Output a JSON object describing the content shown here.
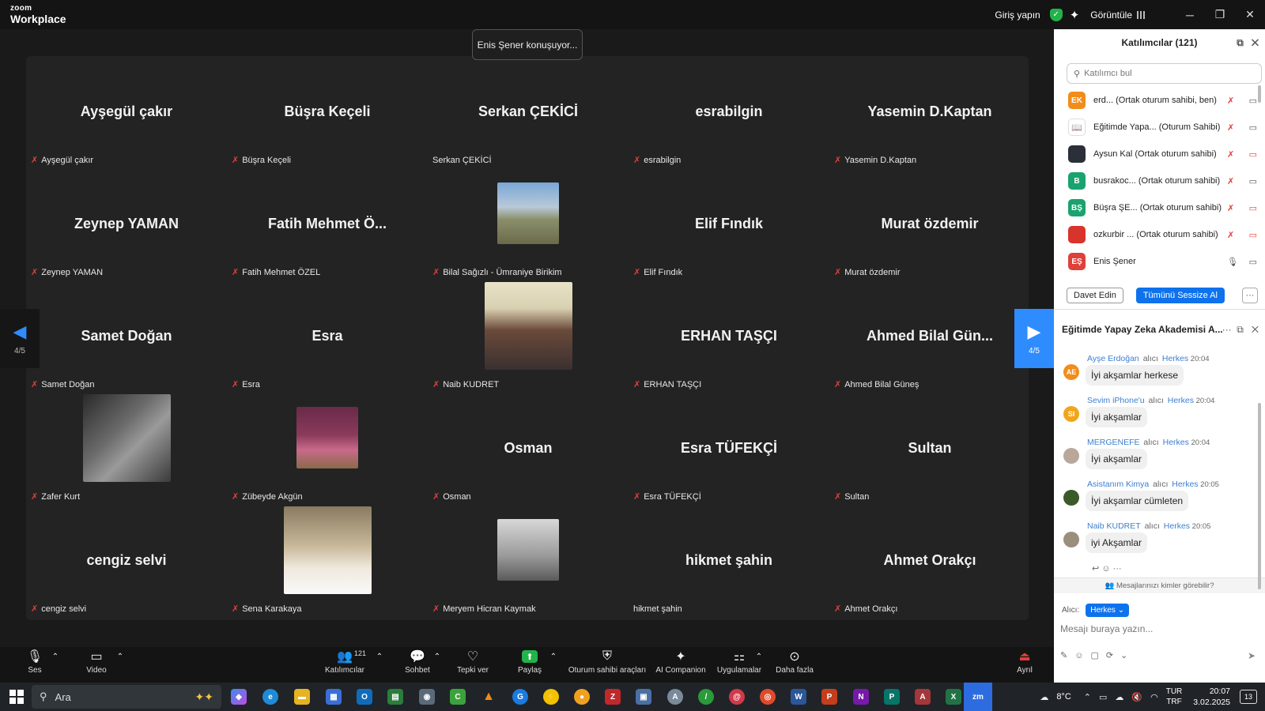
{
  "app": {
    "logo_top": "zoom",
    "logo_bottom": "Workplace"
  },
  "titlebar": {
    "signin": "Giriş yapın",
    "view": "Görüntüle",
    "min": "─",
    "max": "❐",
    "close": "✕"
  },
  "speaking": "Enis Şener konuşuyor...",
  "nav": {
    "left_page": "4/5",
    "right_page": "4/5"
  },
  "tiles": [
    {
      "big": "Ayşegül çakır",
      "label": "Ayşegül çakır",
      "muted": true
    },
    {
      "big": "Büşra Keçeli",
      "label": "Büşra Keçeli",
      "muted": true
    },
    {
      "big": "Serkan ÇEKİCİ",
      "label": "Serkan ÇEKİCİ",
      "muted": false
    },
    {
      "big": "esrabilgin",
      "label": "esrabilgin",
      "muted": true
    },
    {
      "big": "Yasemin D.Kaptan",
      "label": "Yasemin D.Kaptan",
      "muted": true
    },
    {
      "big": "Zeynep YAMAN",
      "label": "Zeynep YAMAN",
      "muted": true
    },
    {
      "big": "Fatih Mehmet Ö...",
      "label": "Fatih Mehmet ÖZEL",
      "muted": true
    },
    {
      "big": "",
      "label": "Bilal Sağızlı - Ümraniye Birikim",
      "muted": true,
      "photo": "landscape"
    },
    {
      "big": "Elif Fındık",
      "label": "Elif Fındık",
      "muted": true
    },
    {
      "big": "Murat özdemir",
      "label": "Murat özdemir",
      "muted": true
    },
    {
      "big": "Samet Doğan",
      "label": "Samet Doğan",
      "muted": true
    },
    {
      "big": "Esra",
      "label": "Esra",
      "muted": true
    },
    {
      "big": "",
      "label": "Naib KUDRET",
      "muted": true,
      "photo": "portrait"
    },
    {
      "big": "ERHAN TAŞÇI",
      "label": "ERHAN TAŞÇI",
      "muted": true
    },
    {
      "big": "Ahmed Bilal Gün...",
      "label": "Ahmed Bilal Güneş",
      "muted": true
    },
    {
      "big": "",
      "label": "Zafer Kurt",
      "muted": true,
      "photo": "couple"
    },
    {
      "big": "",
      "label": "Zübeyde Akgün",
      "muted": true,
      "photo": "flowers"
    },
    {
      "big": "Osman",
      "label": "Osman",
      "muted": true
    },
    {
      "big": "Esra TÜFEKÇİ",
      "label": "Esra TÜFEKÇİ",
      "muted": true
    },
    {
      "big": "Sultan",
      "label": "Sultan",
      "muted": true
    },
    {
      "big": "cengiz selvi",
      "label": "cengiz selvi",
      "muted": true
    },
    {
      "big": "",
      "label": "Sena Karakaya",
      "muted": true,
      "photo": "decor"
    },
    {
      "big": "",
      "label": "Meryem Hicran Kaymak",
      "muted": true,
      "photo": "misty"
    },
    {
      "big": "hikmet şahin",
      "label": "hikmet şahin",
      "muted": false
    },
    {
      "big": "Ahmet Orakçı",
      "label": "Ahmet Orakçı",
      "muted": true
    }
  ],
  "participants": {
    "title": "Katılımcılar (121)",
    "search_placeholder": "Katılımcı bul",
    "rows": [
      {
        "initials": "EK",
        "color": "#f28c1b",
        "name": "erd...  (Ortak oturum sahibi, ben)",
        "video_off": false
      },
      {
        "initials": "",
        "color": "#ffffff",
        "name": "Eğitimde Yapa...  (Oturum Sahibi)",
        "video_off": false
      },
      {
        "initials": "",
        "color": "#2b2f3a",
        "name": "Aysun Kal (Ortak oturum sahibi)",
        "video_off": true
      },
      {
        "initials": "B",
        "color": "#1aa36e",
        "name": "busrakoc...  (Ortak oturum sahibi)",
        "video_off": false
      },
      {
        "initials": "BŞ",
        "color": "#1aa36e",
        "name": "Büşra ŞE...  (Ortak oturum sahibi)",
        "video_off": true
      },
      {
        "initials": "",
        "color": "#d9342b",
        "name": "ozkurbir ...  (Ortak oturum sahibi)",
        "video_off": true
      },
      {
        "initials": "EŞ",
        "color": "#e0403a",
        "name": "Enis Şener",
        "video_off": false
      }
    ],
    "invite": "Davet Edin",
    "mute_all": "Tümünü Sessize Al",
    "more": "···"
  },
  "chat": {
    "title": "Eğitimde Yapay Zeka Akademisi A...",
    "to_word": "alıcı",
    "messages": [
      {
        "initials": "AE",
        "color": "#f28c1b",
        "sender": "Ayşe Erdoğan",
        "to": "Herkes",
        "time": "20:04",
        "text": "İyi akşamlar herkese"
      },
      {
        "initials": "SI",
        "color": "#f2a51b",
        "sender": "Sevim iPhone'u",
        "to": "Herkes",
        "time": "20:04",
        "text": "İyi akşamlar"
      },
      {
        "initials": "",
        "color": "#b9a89a",
        "sender": "MERGENEFE",
        "to": "Herkes",
        "time": "20:04",
        "text": "İyi akşamlar"
      },
      {
        "initials": "",
        "color": "#3b5a2a",
        "sender": "Asistanım Kimya",
        "to": "Herkes",
        "time": "20:05",
        "text": "İyi akşamlar cümleten"
      },
      {
        "initials": "",
        "color": "#9a8f7c",
        "sender": "Naib KUDRET",
        "to": "Herkes",
        "time": "20:05",
        "text": "iyi Akşamlar"
      }
    ],
    "visible_note": "Mesajlarınızı kimler görebilir?",
    "to_label": "Alıcı:",
    "to_value": "Herkes ⌄",
    "input_placeholder": "Mesajı buraya yazın..."
  },
  "toolbar": {
    "audio": "Ses",
    "video": "Video",
    "participants": "Katılımcılar",
    "participants_count": "121",
    "chat": "Sohbet",
    "react": "Tepki ver",
    "share": "Paylaş",
    "host_tools": "Oturum sahibi araçları",
    "ai": "AI Companion",
    "apps": "Uygulamalar",
    "more": "Daha fazla",
    "leave": "Ayrıl"
  },
  "taskbar": {
    "search": "Ara",
    "temp": "8°C",
    "lang1": "TUR",
    "lang2": "TRF",
    "time": "20:07",
    "date": "3.02.2025",
    "notif": "13"
  }
}
